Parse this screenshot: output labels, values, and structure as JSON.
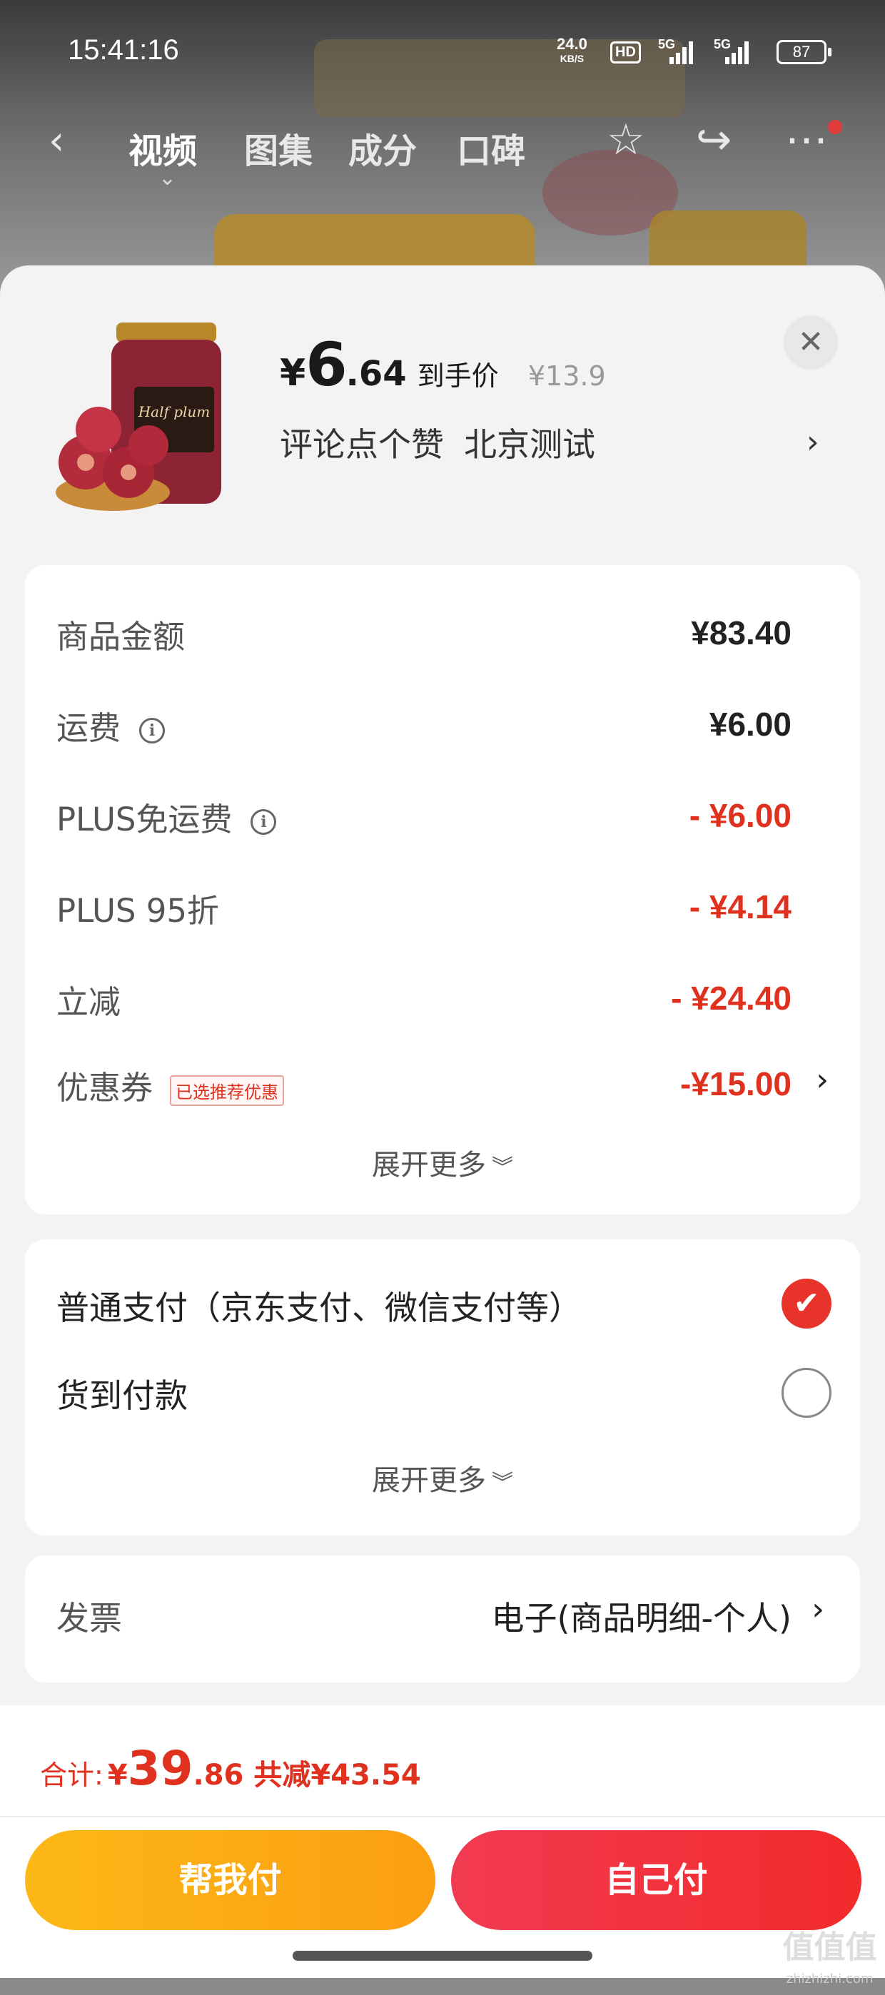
{
  "status_bar": {
    "time": "15:41:16",
    "net_speed": "24.0",
    "net_unit": "KB/S",
    "hd": "HD",
    "sig1": "5G",
    "sig2": "5G",
    "battery": "87"
  },
  "topnav": {
    "tabs": [
      {
        "label": "视频"
      },
      {
        "label": "图集"
      },
      {
        "label": "成分"
      },
      {
        "label": "口碑"
      }
    ],
    "icons": [
      "back-arrow-icon",
      "star-icon",
      "share-icon",
      "more-icon"
    ]
  },
  "product": {
    "price_yen": "¥",
    "price_int": "6",
    "price_dec": ".64",
    "price_label": "到手价",
    "original_price": "¥13.9",
    "spec1": "评论点个赞",
    "spec2": "北京测试",
    "image_label": "Half plum"
  },
  "breakdown": {
    "rows": [
      {
        "label": "商品金额",
        "value": "¥83.40",
        "info": false
      },
      {
        "label": "运费",
        "value": "¥6.00",
        "info": true
      },
      {
        "label": "PLUS免运费",
        "value": "- ¥6.00",
        "info": true
      },
      {
        "label": "PLUS 95折",
        "value": "- ¥4.14",
        "info": false
      },
      {
        "label": "立减",
        "value": "- ¥24.40",
        "info": false
      },
      {
        "label": "优惠券",
        "value": "-¥15.00",
        "tag": "已选推荐优惠"
      }
    ],
    "expand": "展开更多"
  },
  "payment": {
    "options": [
      {
        "label": "普通支付（京东支付、微信支付等）",
        "selected": true
      },
      {
        "label": "货到付款",
        "selected": false
      }
    ],
    "expand": "展开更多"
  },
  "invoice": {
    "label": "发票",
    "value": "电子(商品明细-个人)"
  },
  "footer": {
    "total_label": "合计:",
    "total_yen": "¥",
    "total_int": "39",
    "total_dec": ".86",
    "saved": "共减¥43.54",
    "help_pay": "帮我付",
    "self_pay": "自己付",
    "watermark": "值值值",
    "watermark_url": "zhizhizhi.com"
  },
  "colors": {
    "accent_red": "#e0301e",
    "button_yellow": "#fcb817",
    "button_red": "#f22b2b"
  }
}
